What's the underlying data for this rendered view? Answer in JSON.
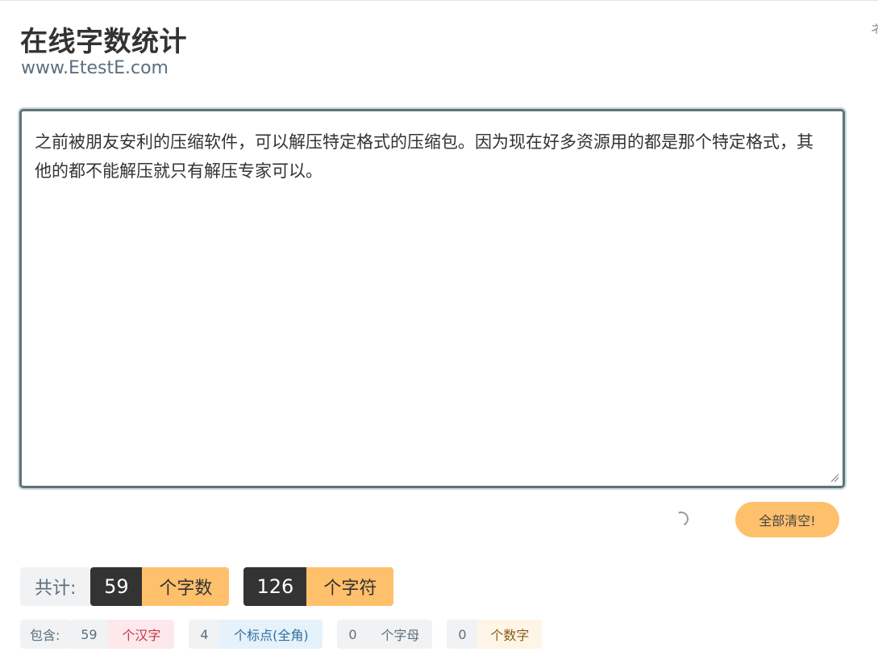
{
  "header": {
    "title": "在线字数统计",
    "subtitle": "www.EtestE.com",
    "edge_glyph": "ネ"
  },
  "editor": {
    "text": "之前被朋友安利的压缩软件，可以解压特定格式的压缩包。因为现在好多资源用的都是那个特定格式，其他的都不能解压就只有解压专家可以。"
  },
  "actions": {
    "clear_label": "全部清空!"
  },
  "totals": {
    "label": "共计:",
    "chars_count": "59",
    "chars_unit": "个字数",
    "symbols_count": "126",
    "symbols_unit": "个字符"
  },
  "breakdown": {
    "label": "包含:",
    "items": [
      {
        "count": "59",
        "unit": "个汉字",
        "color": "#c0394b",
        "bg": "#fde8ec"
      },
      {
        "count": "4",
        "unit": "个标点(全角)",
        "color": "#2e6f9e",
        "bg": "#e6f2fb"
      },
      {
        "count": "0",
        "unit": "个字母",
        "color": "#5b6f7e",
        "bg": "#f1f2f3"
      },
      {
        "count": "0",
        "unit": "个数字",
        "color": "#8a5a1a",
        "bg": "#fff5e6"
      }
    ]
  }
}
